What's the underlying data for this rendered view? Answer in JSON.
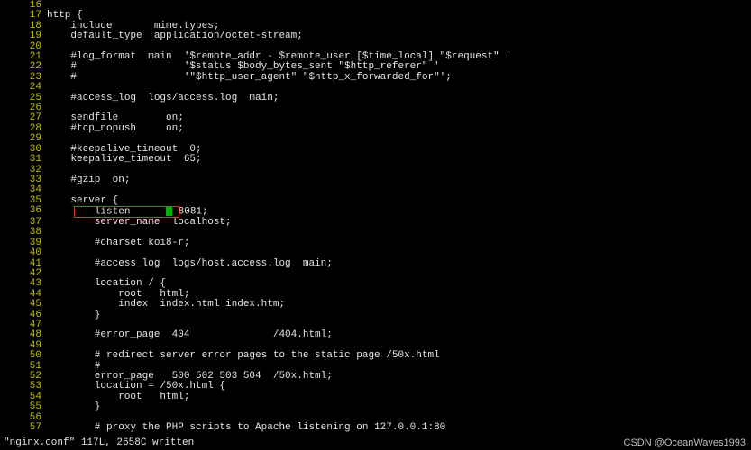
{
  "editor": {
    "filename": "nginx.conf",
    "status_line": "\"nginx.conf\" 117L, 2658C written",
    "watermark": "CSDN @OceanWaves1993",
    "highlight": {
      "line": 36,
      "text": "listen       8081;"
    },
    "lines": [
      {
        "n": 16,
        "t": ""
      },
      {
        "n": 17,
        "t": "http {"
      },
      {
        "n": 18,
        "t": "    include       mime.types;"
      },
      {
        "n": 19,
        "t": "    default_type  application/octet-stream;"
      },
      {
        "n": 20,
        "t": ""
      },
      {
        "n": 21,
        "t": "    #log_format  main  '$remote_addr - $remote_user [$time_local] \"$request\" '"
      },
      {
        "n": 22,
        "t": "    #                  '$status $body_bytes_sent \"$http_referer\" '"
      },
      {
        "n": 23,
        "t": "    #                  '\"$http_user_agent\" \"$http_x_forwarded_for\"';"
      },
      {
        "n": 24,
        "t": ""
      },
      {
        "n": 25,
        "t": "    #access_log  logs/access.log  main;"
      },
      {
        "n": 26,
        "t": ""
      },
      {
        "n": 27,
        "t": "    sendfile        on;"
      },
      {
        "n": 28,
        "t": "    #tcp_nopush     on;"
      },
      {
        "n": 29,
        "t": ""
      },
      {
        "n": 30,
        "t": "    #keepalive_timeout  0;"
      },
      {
        "n": 31,
        "t": "    keepalive_timeout  65;"
      },
      {
        "n": 32,
        "t": ""
      },
      {
        "n": 33,
        "t": "    #gzip  on;"
      },
      {
        "n": 34,
        "t": ""
      },
      {
        "n": 35,
        "t": "    server {"
      },
      {
        "n": 36,
        "t": "        listen       8081;",
        "cursor_before": " 8081;"
      },
      {
        "n": 37,
        "t": "        server_name  localhost;"
      },
      {
        "n": 38,
        "t": ""
      },
      {
        "n": 39,
        "t": "        #charset koi8-r;"
      },
      {
        "n": 40,
        "t": ""
      },
      {
        "n": 41,
        "t": "        #access_log  logs/host.access.log  main;"
      },
      {
        "n": 42,
        "t": ""
      },
      {
        "n": 43,
        "t": "        location / {"
      },
      {
        "n": 44,
        "t": "            root   html;"
      },
      {
        "n": 45,
        "t": "            index  index.html index.htm;"
      },
      {
        "n": 46,
        "t": "        }"
      },
      {
        "n": 47,
        "t": ""
      },
      {
        "n": 48,
        "t": "        #error_page  404              /404.html;"
      },
      {
        "n": 49,
        "t": ""
      },
      {
        "n": 50,
        "t": "        # redirect server error pages to the static page /50x.html"
      },
      {
        "n": 51,
        "t": "        #"
      },
      {
        "n": 52,
        "t": "        error_page   500 502 503 504  /50x.html;"
      },
      {
        "n": 53,
        "t": "        location = /50x.html {"
      },
      {
        "n": 54,
        "t": "            root   html;"
      },
      {
        "n": 55,
        "t": "        }"
      },
      {
        "n": 56,
        "t": ""
      },
      {
        "n": 57,
        "t": "        # proxy the PHP scripts to Apache listening on 127.0.0.1:80"
      }
    ]
  }
}
